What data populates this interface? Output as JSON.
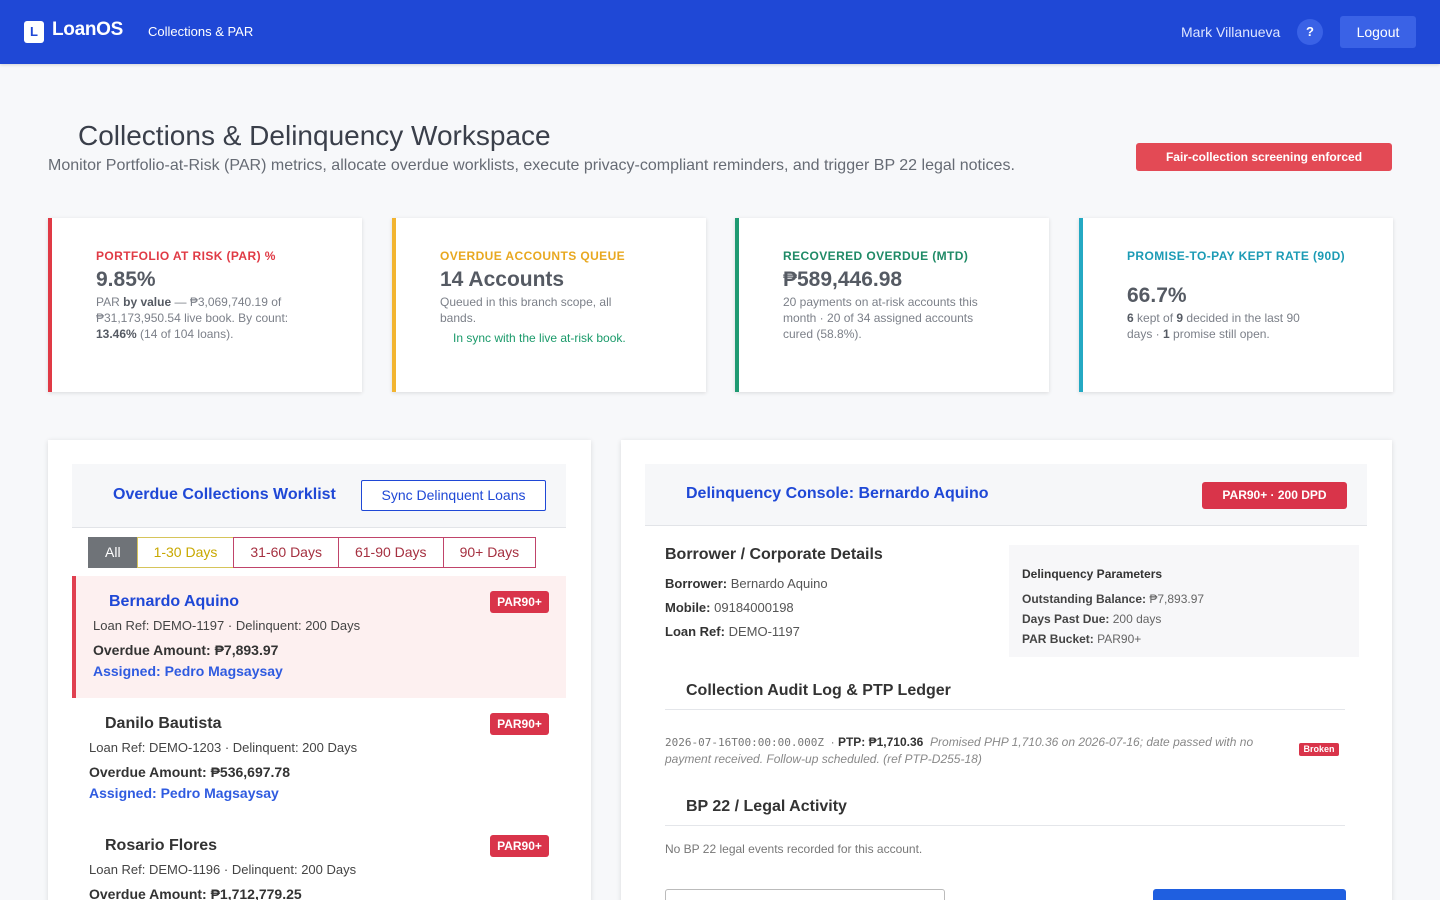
{
  "header": {
    "logo_letter": "L",
    "app_name": "LoanOS",
    "nav_link": "Collections & PAR",
    "user_name": "Mark Villanueva",
    "help_label": "?",
    "logout_label": "Logout"
  },
  "page": {
    "title": "Collections & Delinquency Workspace",
    "subtitle": "Monitor Portfolio-at-Risk (PAR) metrics, allocate overdue worklists, execute privacy-compliant reminders, and trigger BP 22 legal notices.",
    "compliance_badge": "Fair-collection screening enforced"
  },
  "kpis": [
    {
      "label": "PORTFOLIO AT RISK (PAR) %",
      "value": "9.85%",
      "color": "#e03a45",
      "desc_html_parts": [
        "PAR ",
        "by value",
        " — ₱3,069,740.19 of ₱31,173,950.54 live book. By count: ",
        "13.46%",
        " (14 of 104 loans)."
      ]
    },
    {
      "label": "OVERDUE ACCOUNTS QUEUE",
      "value": "14 Accounts",
      "color": "#f2b430",
      "desc": "Queued in this branch scope, all bands.",
      "note": "In sync with the live at-risk book."
    },
    {
      "label": "RECOVERED OVERDUE (MTD)",
      "value": "₱589,446.98",
      "color": "#1f9a72",
      "desc": "20 payments on at-risk accounts this month · 20 of 34 assigned accounts cured (58.8%)."
    },
    {
      "label": "PROMISE-TO-PAY KEPT RATE (90D)",
      "value": "66.7%",
      "color": "#24a9c3",
      "desc_parts": [
        "6",
        " kept of ",
        "9",
        " decided in the last 90 days · ",
        "1",
        " promise still open."
      ]
    }
  ],
  "worklist": {
    "title": "Overdue Collections Worklist",
    "sync_label": "Sync Delinquent Loans",
    "filters": [
      "All",
      "1-30 Days",
      "31-60 Days",
      "61-90 Days",
      "90+ Days"
    ],
    "active_filter": "All",
    "rows": [
      {
        "name": "Bernardo Aquino",
        "ref": "Loan Ref: DEMO-1197 · Delinquent: 200 Days",
        "amount": "Overdue Amount: ₱7,893.97",
        "assigned": "Assigned: Pedro Magsaysay",
        "badge": "PAR90+",
        "selected": true
      },
      {
        "name": "Danilo Bautista",
        "ref": "Loan Ref: DEMO-1203 · Delinquent: 200 Days",
        "amount": "Overdue Amount: ₱536,697.78",
        "assigned": "Assigned: Pedro Magsaysay",
        "badge": "PAR90+",
        "selected": false
      },
      {
        "name": "Rosario Flores",
        "ref": "Loan Ref: DEMO-1196 · Delinquent: 200 Days",
        "amount": "Overdue Amount: ₱1,712,779.25",
        "badge": "PAR90+",
        "selected": false
      }
    ]
  },
  "console": {
    "title": "Delinquency Console: Bernardo Aquino",
    "badge": "PAR90+ · 200 DPD",
    "borrower_section": "Borrower / Corporate Details",
    "borrower_label": "Borrower:",
    "borrower_value": "Bernardo Aquino",
    "mobile_label": "Mobile:",
    "mobile_value": "09184000198",
    "loanref_label": "Loan Ref:",
    "loanref_value": "DEMO-1197",
    "params_title": "Delinquency Parameters",
    "balance_label": "Outstanding Balance:",
    "balance_value": "₱7,893.97",
    "dpd_label": "Days Past Due:",
    "dpd_value": "200 days",
    "bucket_label": "PAR Bucket:",
    "bucket_value": "PAR90+",
    "audit_section": "Collection Audit Log & PTP Ledger",
    "log": {
      "timestamp": "2026-07-16T00:00:00.000Z",
      "ptp_label": "PTP: ₱1,710.36",
      "note": "Promised PHP 1,710.36 on 2026-07-16; date passed with no payment received. Follow-up scheduled. (ref PTP-D255-18)",
      "status": "Broken"
    },
    "legal_section": "BP 22 / Legal Activity",
    "legal_empty": "No BP 22 legal events recorded for this account."
  }
}
